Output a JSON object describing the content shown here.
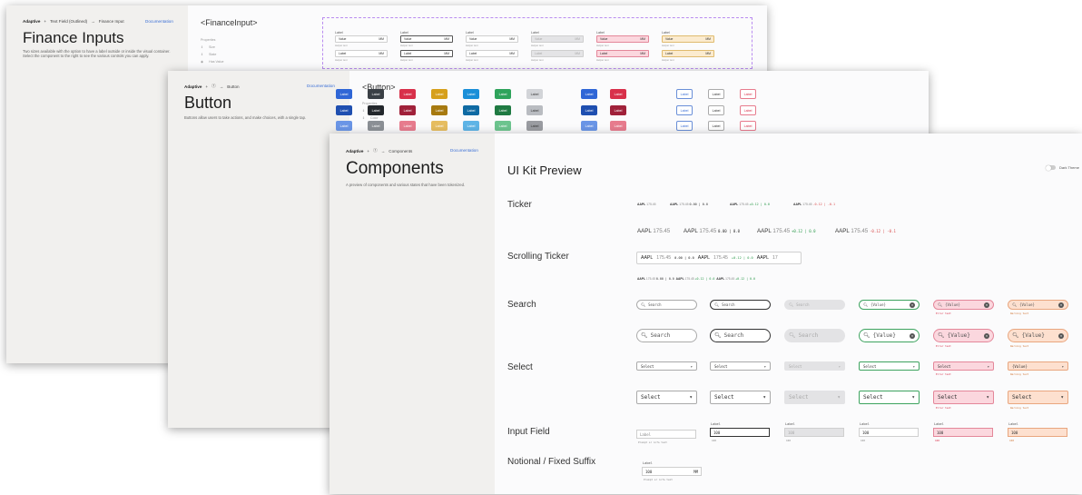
{
  "finance_window": {
    "breadcrumb": {
      "logo": "Adaptive",
      "sep": "+",
      "item1": "Text Field (Outlined)",
      "arrow": "→",
      "current": "Finance Input"
    },
    "documentation": "Documentation",
    "title": "Finance Inputs",
    "description": "Two sizes available with the option to have a label outside or inside the visual container. Select the component to the right to see the various controls you can apply.",
    "component_name": "<FinanceInput>",
    "properties_label": "Properties",
    "properties": [
      "Size",
      "State",
      "Has Value"
    ],
    "field": {
      "label": "Label",
      "value": "Value",
      "suffix": "MM",
      "helper": "Helper text"
    }
  },
  "button_window": {
    "breadcrumb": {
      "logo": "Adaptive",
      "sep": "+",
      "arrow": "→",
      "current": "Button"
    },
    "documentation": "Documentation",
    "title": "Button",
    "description": "Buttons allow users to take actions, and make choices, with a single tap.",
    "component_name": "<Button>",
    "properties_label": "Properties",
    "properties": [
      "Size",
      "Color"
    ],
    "button_label": "Label",
    "colors": {
      "blue": "#2f66d6",
      "dark": "#3a3f45",
      "red": "#d8304a",
      "gold": "#d6a01c",
      "teal": "#1a8fd8",
      "green": "#2ea35b",
      "grey": "#d2d4d8"
    }
  },
  "components_window": {
    "breadcrumb": {
      "logo": "Adaptive",
      "sep": "+",
      "arrow": "→",
      "current": "Components"
    },
    "documentation": "Documentation",
    "title": "Components",
    "description": "A preview of components and various states that have been tokenized.",
    "preview_title": "UI Kit Preview",
    "dark_theme": "Dark Theme",
    "sections": {
      "ticker": "Ticker",
      "scrolling": "Scrolling Ticker",
      "search": "Search",
      "select": "Select",
      "input": "Input Field",
      "notional": "Notional / Fixed Suffix"
    },
    "ticker": {
      "symbol": "AAPL",
      "price": "175.45",
      "neutral": "0.00 | 0.0",
      "up": "+0.12 | 0.0",
      "down": "-0.12 | -0.1"
    },
    "search": {
      "placeholder": "Search",
      "value": "{Value}",
      "error": "Error text",
      "warning": "Warning text"
    },
    "select": {
      "placeholder": "Select",
      "value": "{Value}",
      "error": "Error text",
      "warning": "Warning text"
    },
    "input": {
      "label": "Label",
      "value": "100",
      "helper": "Prompt or info text",
      "suffix": "MM"
    },
    "colors": {
      "error_bg": "#fbd7de",
      "error_border": "#e4879a",
      "warn_bg": "#fde0cf",
      "warn_border": "#e9a67f",
      "success_border": "#3da35f"
    }
  }
}
